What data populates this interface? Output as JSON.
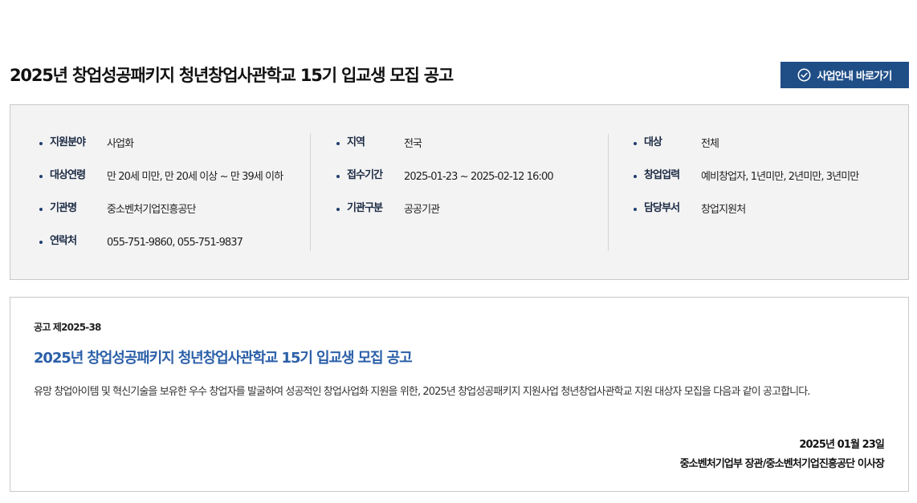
{
  "header": {
    "title": "2025년 창업성공패키지 청년창업사관학교 15기 입교생 모집 공고",
    "guide_button": {
      "label": "사업안내 바로가기",
      "icon": "check-circle-icon"
    }
  },
  "info": {
    "columns": [
      [
        {
          "label": "지원분야",
          "value": "사업화"
        },
        {
          "label": "대상연령",
          "value": "만 20세 미만, 만 20세 이상 ~ 만 39세 이하"
        },
        {
          "label": "기관명",
          "value": "중소벤처기업진흥공단"
        },
        {
          "label": "연락처",
          "value": "055-751-9860, 055-751-9837"
        }
      ],
      [
        {
          "label": "지역",
          "value": "전국"
        },
        {
          "label": "접수기간",
          "value": "2025-01-23 ~ 2025-02-12 16:00"
        },
        {
          "label": "기관구분",
          "value": "공공기관"
        }
      ],
      [
        {
          "label": "대상",
          "value": "전체"
        },
        {
          "label": "창업업력",
          "value": "예비창업자, 1년미만, 2년미만, 3년미만"
        },
        {
          "label": "담당부서",
          "value": "창업지원처"
        }
      ]
    ]
  },
  "notice": {
    "number": "공고 제2025-38",
    "title": "2025년 창업성공패키지 청년창업사관학교 15기 입교생 모집 공고",
    "body": "유망 창업아이템 및 혁신기술을 보유한 우수 창업자를 발굴하여 성공적인 창업사업화 지원을 위한, 2025년 창업성공패키지 지원사업 청년창업사관학교 지원 대상자 모집을 다음과 같이 공고합니다.",
    "date": "2025년 01월 23일",
    "signature": "중소벤처기업부 장관/중소벤처기업진흥공단 이사장"
  },
  "colors": {
    "accent": "#1f4e87",
    "title_blue": "#2b5fa8",
    "panel_bg": "#f3f3f3"
  }
}
